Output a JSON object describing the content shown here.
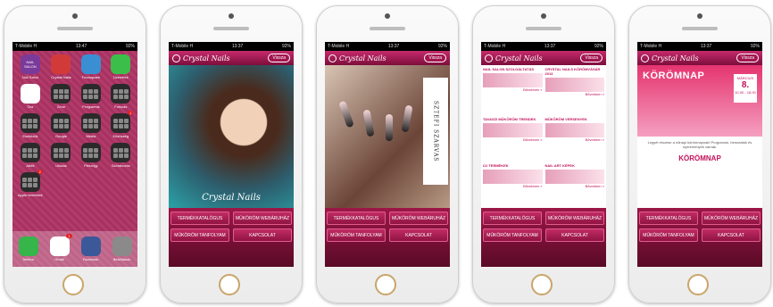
{
  "phones": {
    "p1": {
      "status": {
        "carrier": "T-Mobile H",
        "time": "13:47",
        "battery": "92%"
      },
      "apps": [
        {
          "label": "Nail Salon",
          "icon": "NAIL SALON"
        },
        {
          "label": "Crystal Nails",
          "icon": "crystal-logo-icon"
        },
        {
          "label": "Foursquare",
          "icon": "check-icon"
        },
        {
          "label": "Üzenetek",
          "icon": "speech-bubble-icon"
        },
        {
          "label": "Óra",
          "icon": "clock-icon"
        },
        {
          "label": "Zene",
          "icon": "folder-icon"
        },
        {
          "label": "Programok",
          "icon": "folder-icon"
        },
        {
          "label": "Fotózás",
          "icon": "folder-icon"
        },
        {
          "label": "Eszközök",
          "icon": "folder-icon"
        },
        {
          "label": "Google",
          "icon": "folder-icon"
        },
        {
          "label": "Média",
          "icon": "folder-icon"
        },
        {
          "label": "Közösség",
          "icon": "folder-icon",
          "badge": "1"
        },
        {
          "label": "Játék",
          "icon": "folder-icon"
        },
        {
          "label": "Utazás",
          "icon": "folder-icon"
        },
        {
          "label": "Pénzügy",
          "icon": "folder-icon"
        },
        {
          "label": "Szórakozás",
          "icon": "folder-icon"
        },
        {
          "label": "Apple termékek",
          "icon": "folder-icon",
          "badge": "2"
        }
      ],
      "dock": [
        {
          "label": "Telefon",
          "icon": "phone-icon"
        },
        {
          "label": "Gmail",
          "icon": "gmail-icon",
          "badge": "1"
        },
        {
          "label": "Facebook",
          "icon": "facebook-icon"
        },
        {
          "label": "Beállítások",
          "icon": "settings-icon"
        }
      ]
    },
    "status_common": {
      "carrier": "T-Mobile H",
      "time": "13:37",
      "battery": "92%"
    },
    "app": {
      "logo": "Crystal Nails",
      "back_label": "Vissza",
      "menu": {
        "catalog": "TERMÉKKATALÓGUS",
        "webshop": "MŰKÖRÖM WEBÁRUHÁZ",
        "courses": "MŰKÖRÖM TANFOLYAM",
        "contact": "KAPCSOLAT"
      }
    },
    "p2": {
      "hero_logo": "Crystal Nails"
    },
    "p3": {
      "hero_strip": "SZTEFI SZARVAS"
    },
    "p4": {
      "news": [
        {
          "title": "NAIL SALON SZOLGÁLTATÁS",
          "more": "Bővebben »"
        },
        {
          "title": "CRYSTAL NAILS KÖRÖMVÁSÁR 2013",
          "more": "Bővebben »"
        },
        {
          "title": "TAVASZI MŰKÖRÖM TRENDEK",
          "more": "Bővebben »"
        },
        {
          "title": "MŰKÖRÖM VERSENYEK",
          "more": "Bővebben »"
        },
        {
          "title": "ÚJ TERMÉKEK",
          "more": "Bővebben »"
        },
        {
          "title": "NAIL ART KÉPEK",
          "more": "Bővebben »"
        }
      ]
    },
    "p5": {
      "event_title": "KÖRÖMNAP",
      "event_month": "MÁRCIUS",
      "event_day": "8.",
      "event_time": "10.00 - 18.00",
      "event_text": "Legyél részese a nőnapi körömnapnak! Programok, bemutatók és nyeremények várnak.",
      "event_sub": "KÖRÖMNAP"
    }
  }
}
